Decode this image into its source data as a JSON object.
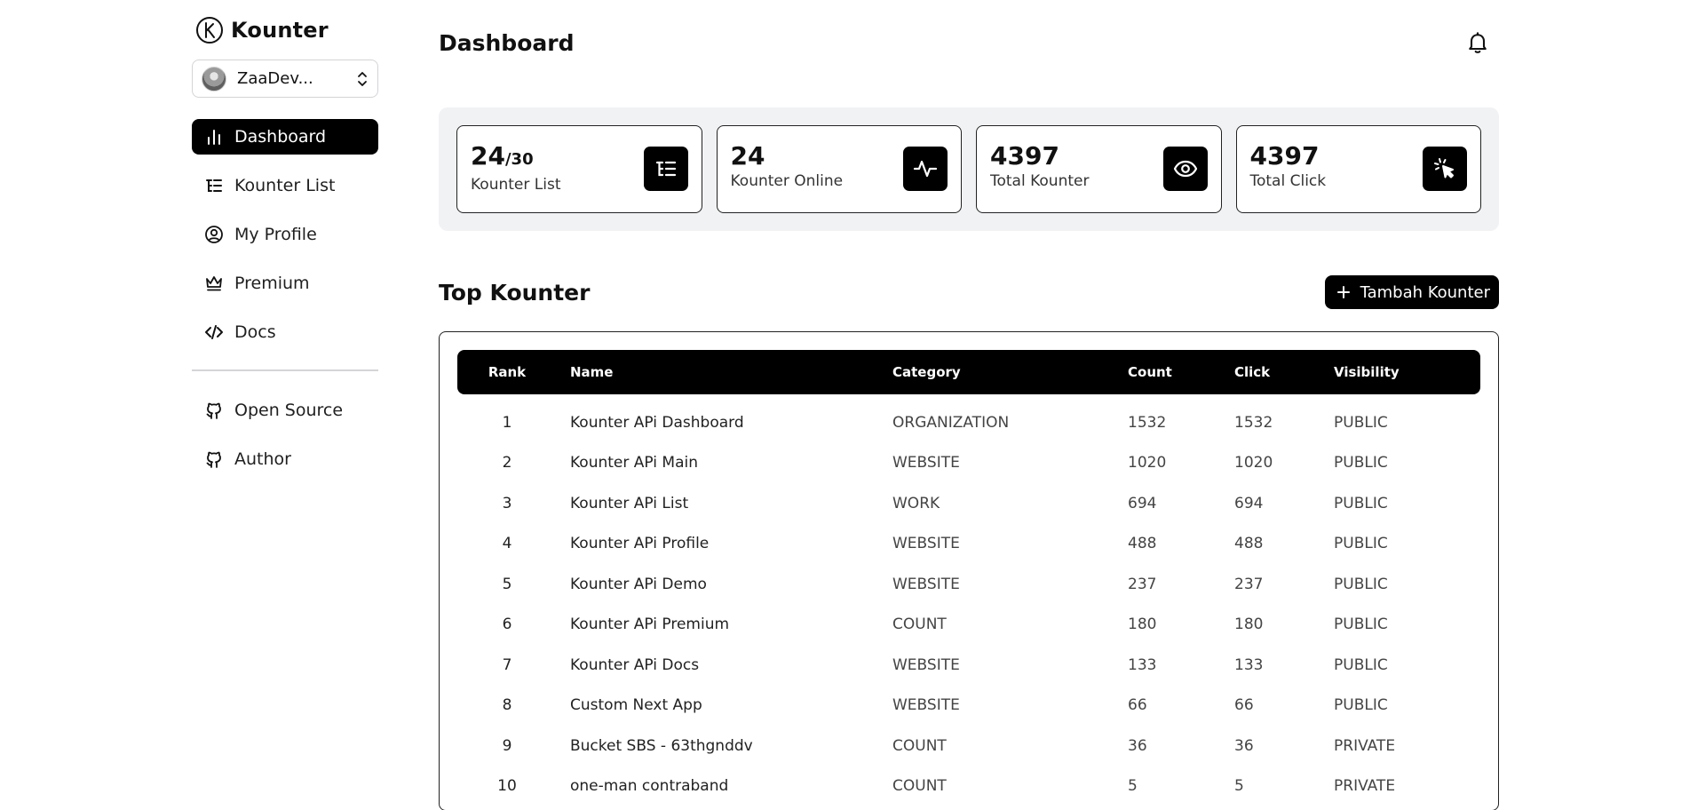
{
  "app": {
    "name": "Kounter"
  },
  "account": {
    "name": "ZaaDev..."
  },
  "nav": {
    "primary": [
      {
        "label": "Dashboard",
        "icon": "bar-chart-icon",
        "active": true
      },
      {
        "label": "Kounter List",
        "icon": "list-tree-icon"
      },
      {
        "label": "My Profile",
        "icon": "user-circle-icon"
      },
      {
        "label": "Premium",
        "icon": "crown-icon"
      },
      {
        "label": "Docs",
        "icon": "code-icon"
      }
    ],
    "secondary": [
      {
        "label": "Open Source",
        "icon": "github-icon"
      },
      {
        "label": "Author",
        "icon": "github-icon"
      }
    ]
  },
  "header": {
    "title": "Dashboard",
    "notification_icon": "bell-icon"
  },
  "stats": [
    {
      "value": "24",
      "sub": "/30",
      "label": "Kounter List",
      "icon": "list-tree-icon"
    },
    {
      "value": "24",
      "sub": "",
      "label": "Kounter Online",
      "icon": "activity-icon"
    },
    {
      "value": "4397",
      "sub": "",
      "label": "Total Kounter",
      "icon": "eye-icon"
    },
    {
      "value": "4397",
      "sub": "",
      "label": "Total Click",
      "icon": "pointer-click-icon"
    }
  ],
  "top_kounter": {
    "title": "Top Kounter",
    "add_button": "Tambah Kounter",
    "columns": [
      "Rank",
      "Name",
      "Category",
      "Count",
      "Click",
      "Visibility"
    ],
    "rows": [
      [
        "1",
        "Kounter APi Dashboard",
        "ORGANIZATION",
        "1532",
        "1532",
        "PUBLIC"
      ],
      [
        "2",
        "Kounter APi Main",
        "WEBSITE",
        "1020",
        "1020",
        "PUBLIC"
      ],
      [
        "3",
        "Kounter APi List",
        "WORK",
        "694",
        "694",
        "PUBLIC"
      ],
      [
        "4",
        "Kounter APi Profile",
        "WEBSITE",
        "488",
        "488",
        "PUBLIC"
      ],
      [
        "5",
        "Kounter APi Demo",
        "WEBSITE",
        "237",
        "237",
        "PUBLIC"
      ],
      [
        "6",
        "Kounter APi Premium",
        "COUNT",
        "180",
        "180",
        "PUBLIC"
      ],
      [
        "7",
        "Kounter APi Docs",
        "WEBSITE",
        "133",
        "133",
        "PUBLIC"
      ],
      [
        "8",
        "Custom Next App",
        "WEBSITE",
        "66",
        "66",
        "PUBLIC"
      ],
      [
        "9",
        "Bucket SBS - 63thgnddv",
        "COUNT",
        "36",
        "36",
        "PRIVATE"
      ],
      [
        "10",
        "one-man contraband",
        "COUNT",
        "5",
        "5",
        "PRIVATE"
      ]
    ]
  },
  "colors": {
    "accent": "#000000",
    "panel": "#f1f2f4",
    "border": "#d4d4d8"
  }
}
